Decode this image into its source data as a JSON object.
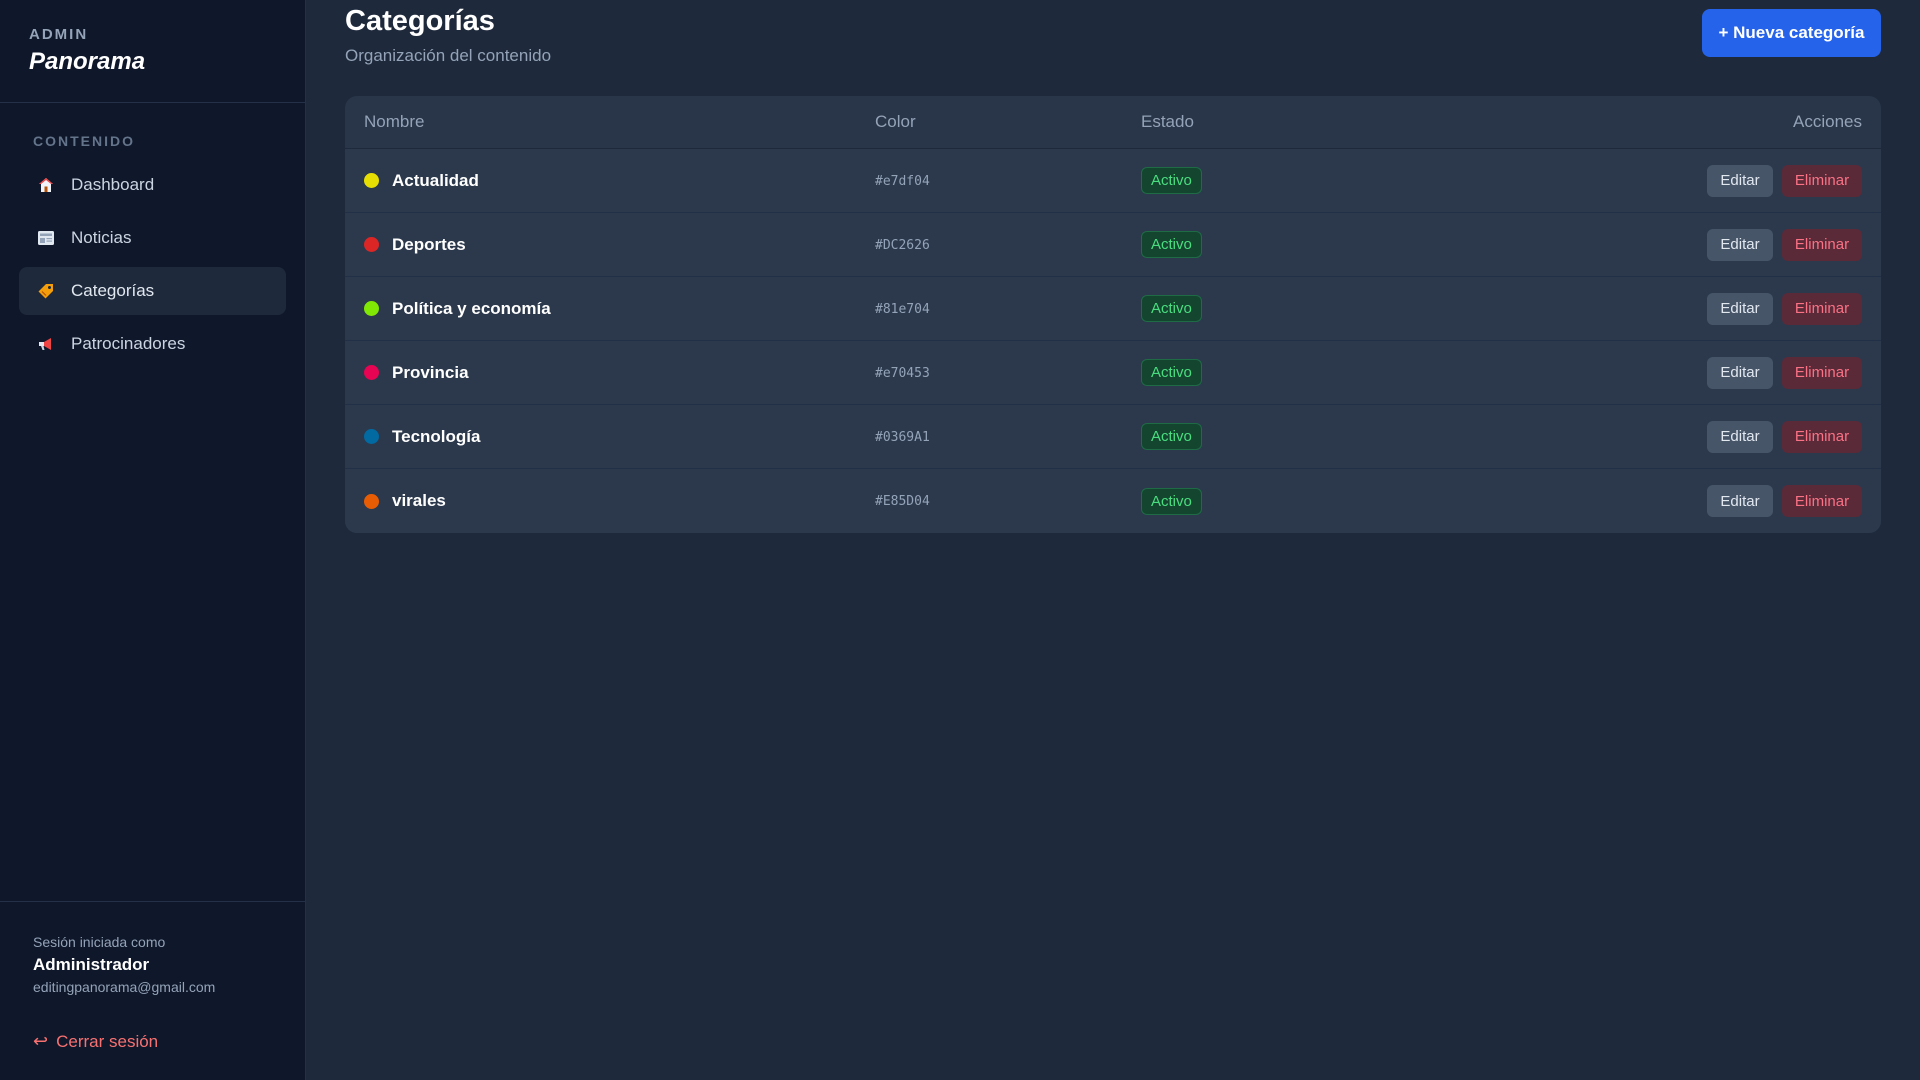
{
  "sidebar": {
    "kicker": "ADMIN",
    "brand": "Panorama",
    "section_label": "CONTENIDO",
    "items": [
      {
        "label": "Dashboard",
        "icon": "house-icon"
      },
      {
        "label": "Noticias",
        "icon": "newspaper-icon"
      },
      {
        "label": "Categorías",
        "icon": "tag-icon",
        "active": true
      },
      {
        "label": "Patrocinadores",
        "icon": "megaphone-icon"
      }
    ],
    "session_label": "Sesión iniciada como",
    "user": "Administrador",
    "email": "editingpanorama@gmail.com",
    "logout": "Cerrar sesión"
  },
  "header": {
    "title": "Categorías",
    "subtitle": "Organización del contenido",
    "new_button": "+ Nueva categoría"
  },
  "table": {
    "columns": [
      "Nombre",
      "Color",
      "Estado",
      "Acciones"
    ],
    "edit_label": "Editar",
    "delete_label": "Eliminar",
    "rows": [
      {
        "name": "Actualidad",
        "color": "#e7df04",
        "status": "Activo"
      },
      {
        "name": "Deportes",
        "color": "#DC2626",
        "status": "Activo"
      },
      {
        "name": "Política y economía",
        "color": "#81e704",
        "status": "Activo"
      },
      {
        "name": "Provincia",
        "color": "#e70453",
        "status": "Activo"
      },
      {
        "name": "Tecnología",
        "color": "#0369A1",
        "status": "Activo"
      },
      {
        "name": "virales",
        "color": "#E85D04",
        "status": "Activo"
      }
    ]
  },
  "colors": {
    "accent": "#2563eb",
    "success": "#4ade80",
    "danger": "#fb7185"
  }
}
